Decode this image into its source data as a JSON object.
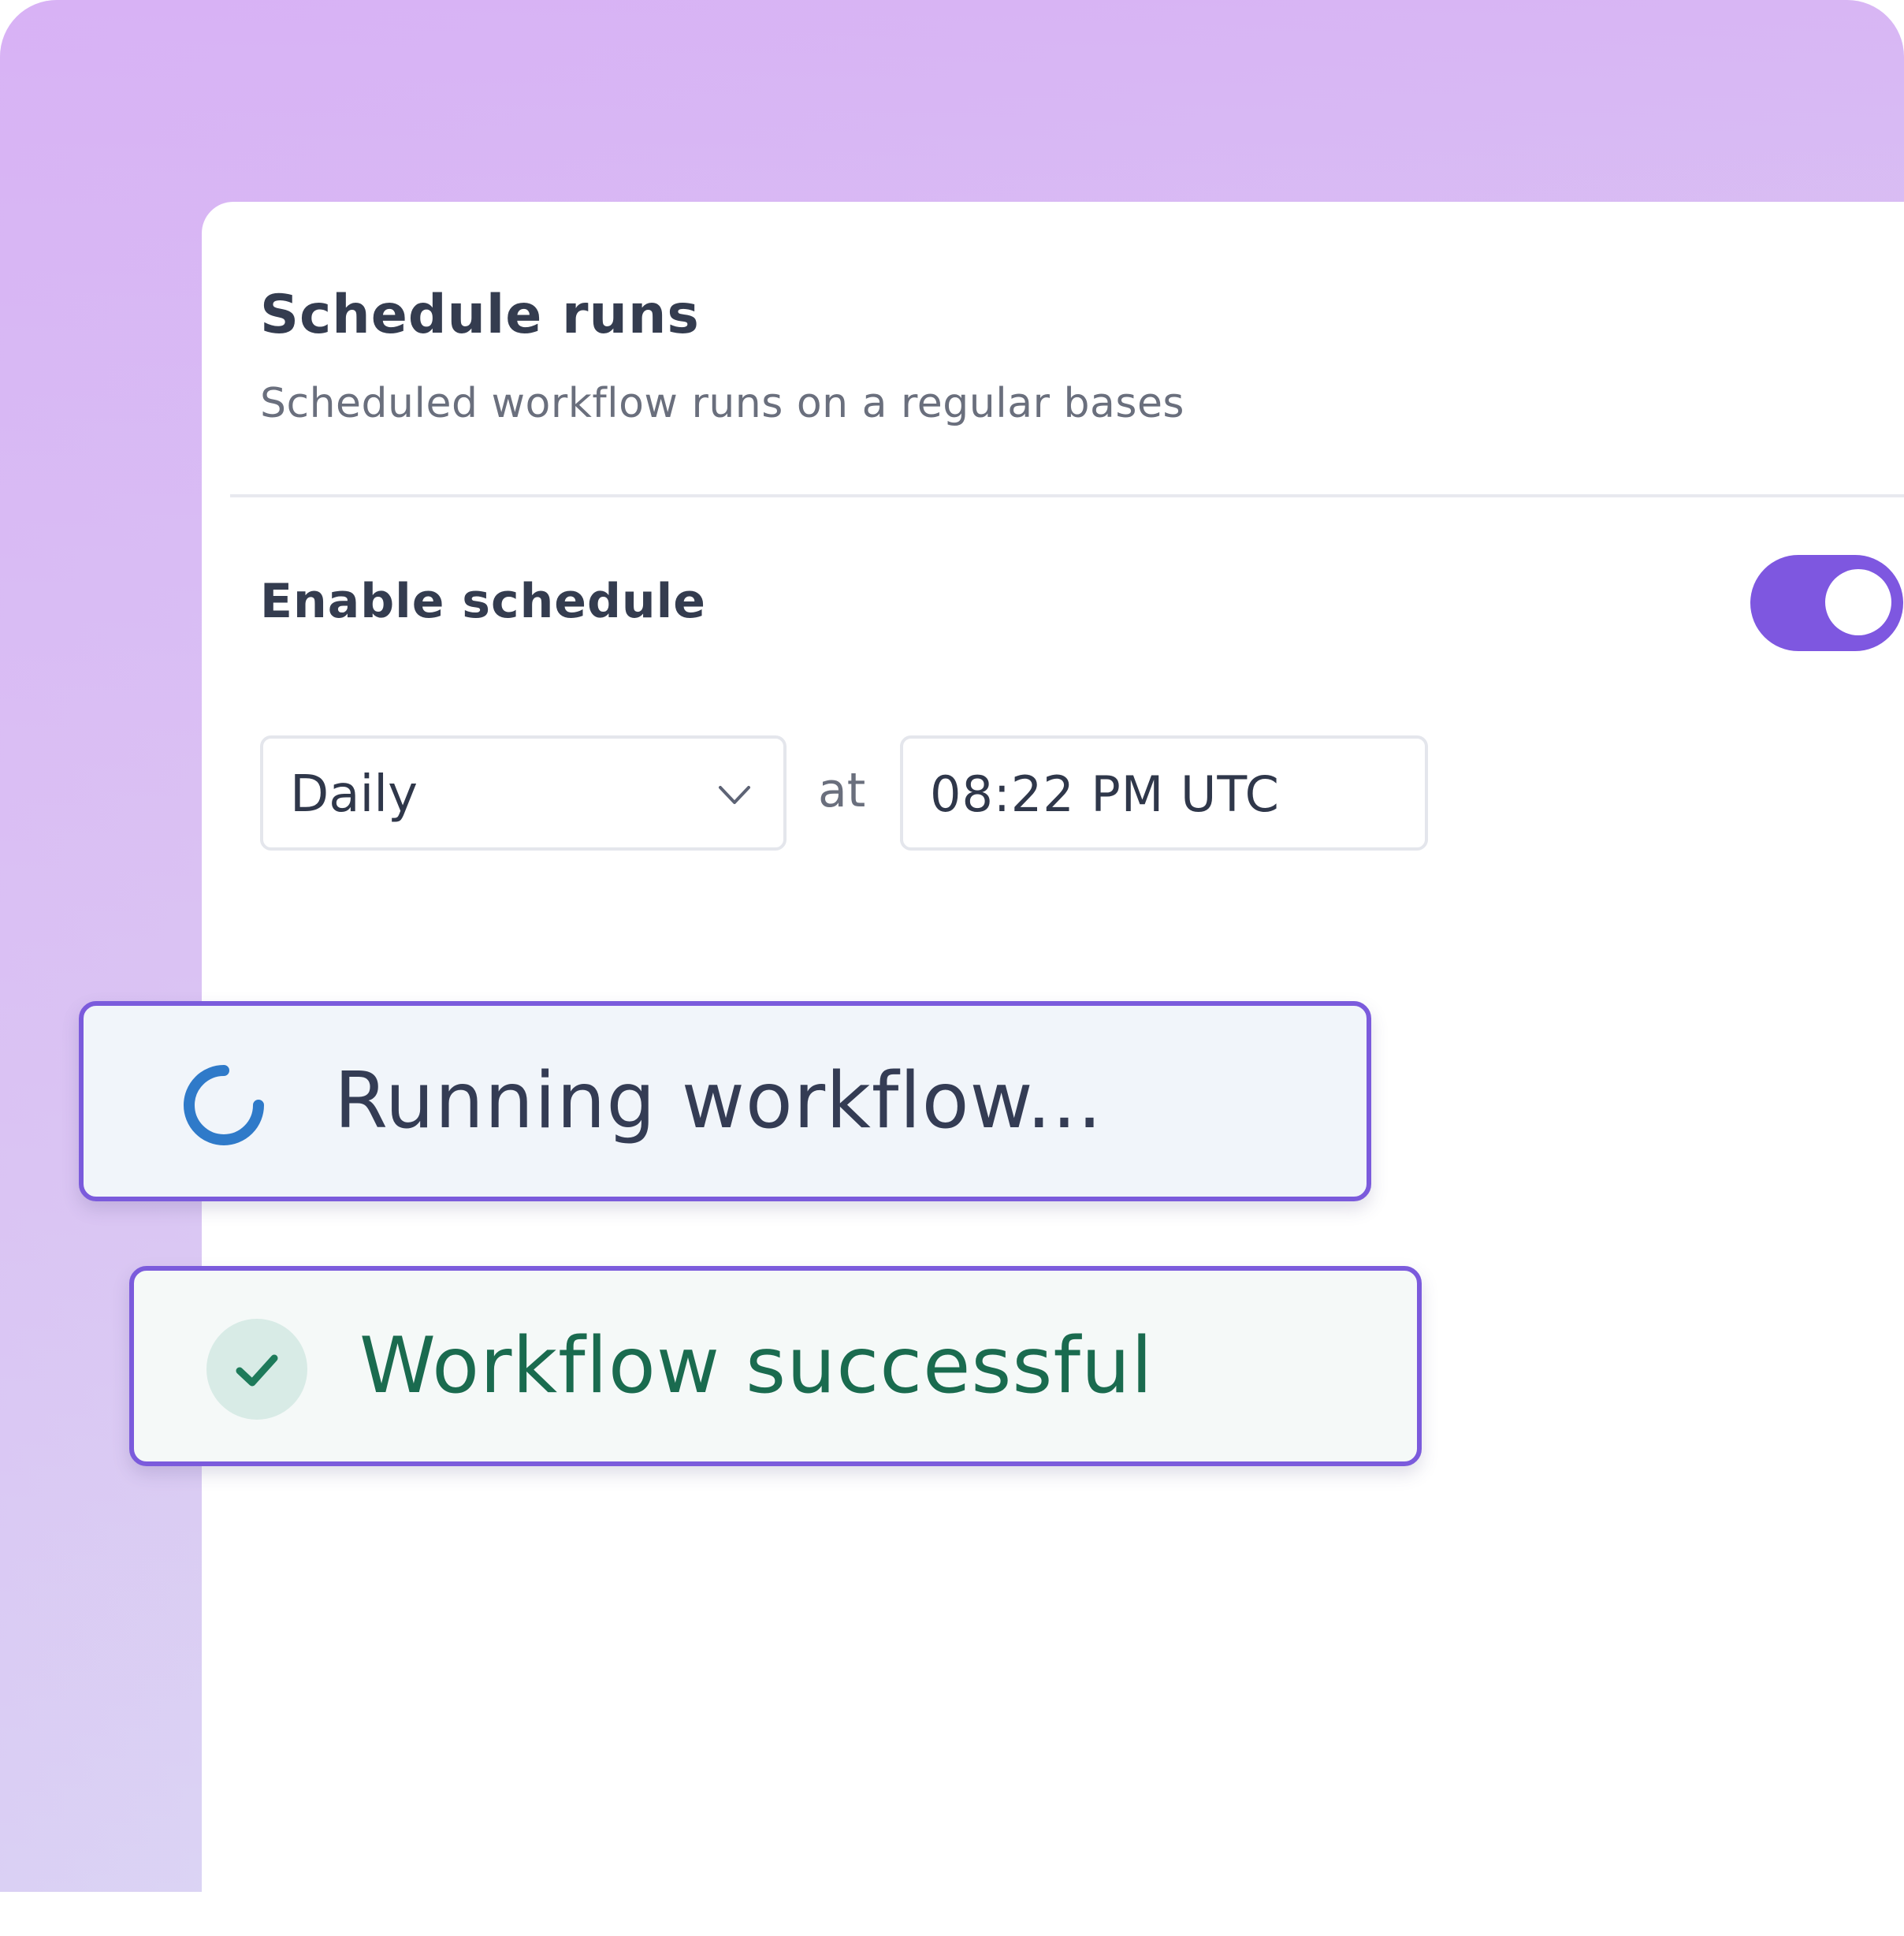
{
  "header": {
    "title": "Schedule runs",
    "subtitle": "Scheduled workflow runs on a regular bases"
  },
  "schedule": {
    "enable_label": "Enable schedule",
    "enabled": true,
    "frequency": "Daily",
    "at_label": "at",
    "time": "08:22 PM UTC"
  },
  "toasts": {
    "running": {
      "text": "Running workflow...",
      "icon": "spinner-icon"
    },
    "success": {
      "text": "Workflow successful",
      "icon": "check-icon"
    }
  },
  "colors": {
    "accent": "#7e57e0",
    "toast_border": "#7b5bdc",
    "spinner": "#2f7ac9",
    "success_text": "#1a6b4f",
    "success_check": "#1d7a5a"
  }
}
